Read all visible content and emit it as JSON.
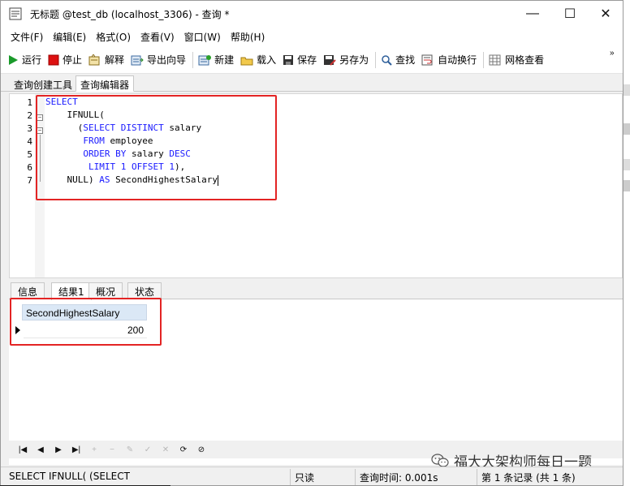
{
  "window": {
    "title": "无标题 @test_db (localhost_3306) - 查询 *",
    "minimize": "—",
    "maximize": "☐",
    "close": "✕"
  },
  "menu": [
    "文件(F)",
    "编辑(E)",
    "格式(O)",
    "查看(V)",
    "窗口(W)",
    "帮助(H)"
  ],
  "toolbar": {
    "run": "运行",
    "stop": "停止",
    "explain": "解释",
    "export": "导出向导",
    "new": "新建",
    "load": "载入",
    "save": "保存",
    "save_as": "另存为",
    "find": "查找",
    "wrap": "自动换行",
    "grid_view": "网格查看",
    "more": "»"
  },
  "tabs": [
    "查询创建工具",
    "查询编辑器"
  ],
  "editor": {
    "line_numbers": [
      "1",
      "2",
      "3",
      "4",
      "5",
      "6",
      "7"
    ],
    "lines": [
      [
        {
          "t": "SELECT",
          "c": "kw"
        }
      ],
      [
        {
          "t": "    IFNULL(",
          "c": "id"
        }
      ],
      [
        {
          "t": "      (",
          "c": "id"
        },
        {
          "t": "SELECT DISTINCT",
          "c": "kw"
        },
        {
          "t": " salary",
          "c": "id"
        }
      ],
      [
        {
          "t": "       ",
          "c": "id"
        },
        {
          "t": "FROM",
          "c": "kw"
        },
        {
          "t": " employee",
          "c": "id"
        }
      ],
      [
        {
          "t": "       ",
          "c": "id"
        },
        {
          "t": "ORDER BY",
          "c": "kw"
        },
        {
          "t": " salary ",
          "c": "id"
        },
        {
          "t": "DESC",
          "c": "kw"
        }
      ],
      [
        {
          "t": "        ",
          "c": "id"
        },
        {
          "t": "LIMIT",
          "c": "kw"
        },
        {
          "t": " ",
          "c": "id"
        },
        {
          "t": "1",
          "c": "num"
        },
        {
          "t": " ",
          "c": "id"
        },
        {
          "t": "OFFSET",
          "c": "kw"
        },
        {
          "t": " ",
          "c": "id"
        },
        {
          "t": "1",
          "c": "num"
        },
        {
          "t": "),",
          "c": "id"
        }
      ],
      [
        {
          "t": "    NULL) ",
          "c": "id"
        },
        {
          "t": "AS",
          "c": "kw"
        },
        {
          "t": " SecondHighestSalary",
          "c": "id"
        }
      ]
    ]
  },
  "result_tabs": [
    "信息",
    "结果1",
    "概况",
    "状态"
  ],
  "result": {
    "columns": [
      "SecondHighestSalary"
    ],
    "rows": [
      [
        "200"
      ]
    ]
  },
  "status": {
    "sql_preview": "SELECT      IFNULL(       (SELECT",
    "mode": "只读",
    "query_time": "查询时间: 0.001s",
    "records": "第 1 条记录 (共 1 条)"
  },
  "watermark": "福大大架构师每日一题",
  "colors": {
    "keyword": "#1a1aff",
    "highlight_box": "#e32424",
    "grid_header": "#dbe8f6"
  }
}
